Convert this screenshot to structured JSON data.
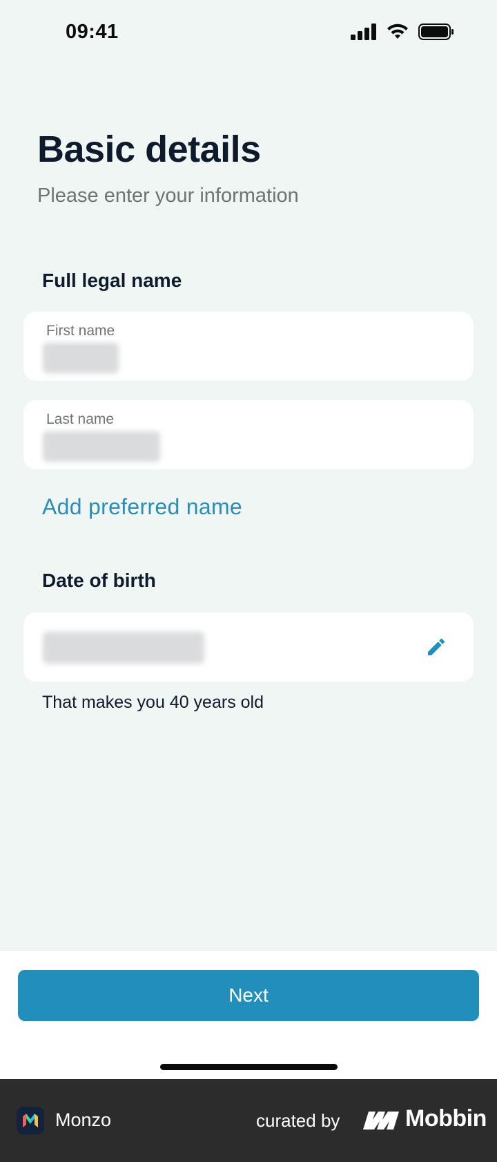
{
  "status_bar": {
    "time": "09:41",
    "icons": [
      "cellular-signal-icon",
      "wifi-icon",
      "battery-icon"
    ]
  },
  "header": {
    "title": "Basic details",
    "subtitle": "Please enter your information"
  },
  "name_section": {
    "label": "Full legal name",
    "first_name": {
      "label": "First name",
      "value_state": "blurred"
    },
    "last_name": {
      "label": "Last name",
      "value_state": "blurred"
    },
    "add_preferred_link": "Add preferred name"
  },
  "dob_section": {
    "label": "Date of birth",
    "value_state": "blurred",
    "edit_icon": "pencil-icon",
    "age_text": "That makes you 40 years old"
  },
  "footer": {
    "next_label": "Next"
  },
  "branding": {
    "app_name": "Monzo",
    "curated_by": "curated by",
    "provider": "Mobbin"
  },
  "colors": {
    "background": "#f0f6f3",
    "accent": "#228fba",
    "link": "#2a8fb5",
    "title": "#0e1b2c",
    "muted": "#6e7476",
    "brand_bar": "#2c2c2c"
  }
}
